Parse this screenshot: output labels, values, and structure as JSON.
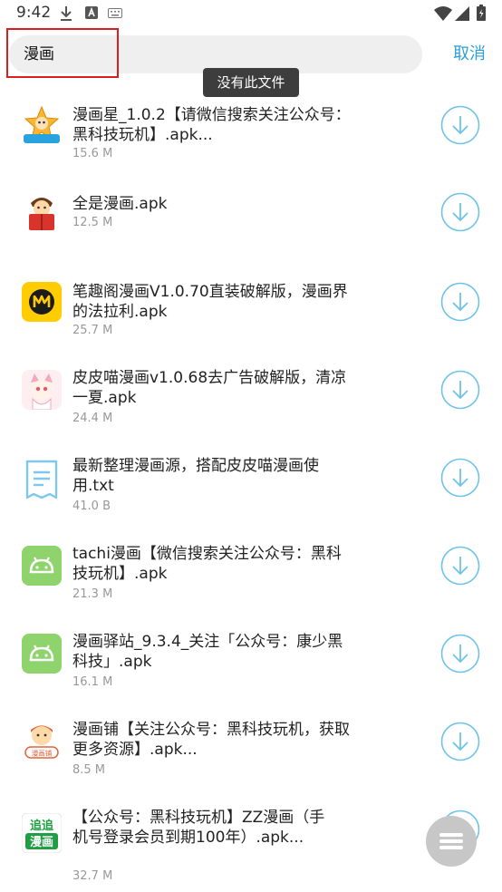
{
  "status": {
    "time": "9:42"
  },
  "search": {
    "query": "漫画",
    "cancel_label": "取消"
  },
  "toast": {
    "text": "没有此文件"
  },
  "colors": {
    "accent": "#2b9fd8",
    "toast_bg": "#3d3d3d",
    "highlight": "#d81e1e",
    "search_bg": "#efefef",
    "android_green": "#8ed36b"
  },
  "files": [
    {
      "name": "漫画星_1.0.2【请微信搜索关注公众号：黑科技玩机】.apk...",
      "size": "15.6 M",
      "icon": "manhuaxing-app-icon"
    },
    {
      "name": "全是漫画.apk",
      "size": "12.5 M",
      "icon": "reading-kid-app-icon"
    },
    {
      "name": "笔趣阁漫画V1.0.70直装破解版，漫画界的法拉利.apk",
      "size": "25.7 M",
      "icon": "biquge-app-icon"
    },
    {
      "name": "皮皮喵漫画v1.0.68去广告破解版，清凉一夏.apk",
      "size": "24.4 M",
      "icon": "pipimiao-app-icon"
    },
    {
      "name": "最新整理漫画源，搭配皮皮喵漫画使用.txt",
      "size": "41.0 B",
      "icon": "text-file-icon"
    },
    {
      "name": "tachi漫画【微信搜索关注公众号：黑科技玩机】.apk",
      "size": "21.3 M",
      "icon": "android-apk-icon"
    },
    {
      "name": "漫画驿站_9.3.4_关注「公众号：康少黑科技」.apk",
      "size": "16.1 M",
      "icon": "android-apk-icon"
    },
    {
      "name": "漫画铺【关注公众号：黑科技玩机，获取更多资源】.apk...",
      "size": "8.5 M",
      "icon": "manhuapu-app-icon"
    },
    {
      "name": "【公众号：黑科技玩机】ZZ漫画（手机号登录会员到期100年）.apk...",
      "size": "32.7 M",
      "icon": "zhuizhui-app-icon"
    }
  ],
  "app_icon_text": {
    "zhuizhui_top": "追追",
    "zhuizhui_bottom": "漫画",
    "manhuapu": "漫画铺"
  }
}
